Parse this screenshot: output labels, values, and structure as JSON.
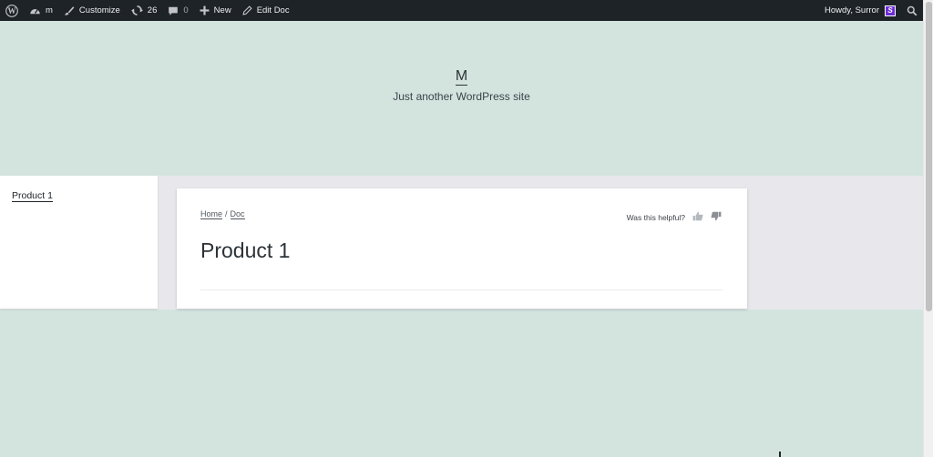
{
  "adminbar": {
    "site_name": "m",
    "customize_label": "Customize",
    "updates_count": "26",
    "comments_count": "0",
    "new_label": "New",
    "edit_label": "Edit Doc",
    "howdy_label": "Howdy, Surror",
    "avatar_letter": "S"
  },
  "header": {
    "site_title": "M",
    "tagline": "Just another WordPress site"
  },
  "sidebar": {
    "items": [
      {
        "label": "Product 1"
      }
    ]
  },
  "breadcrumb": {
    "home": "Home",
    "separator": "/",
    "current": "Doc"
  },
  "feedback": {
    "question": "Was this helpful?"
  },
  "page": {
    "title": "Product 1"
  },
  "colors": {
    "adminbar_bg": "#1d2327",
    "page_bg": "#d3e4df",
    "band_bg": "#e8e8ec",
    "avatar_bg": "#6c2bd9"
  }
}
